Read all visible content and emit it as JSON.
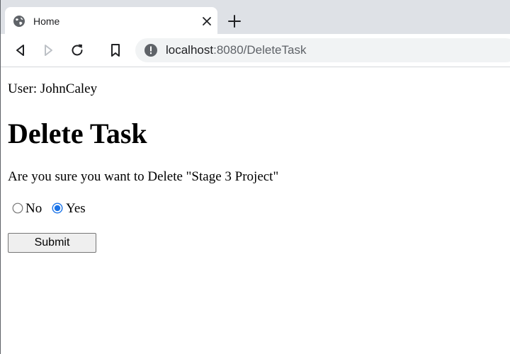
{
  "browser": {
    "tab": {
      "title": "Home",
      "favicon": "globe-icon",
      "close_icon": "close-icon"
    },
    "new_tab_icon": "plus-icon",
    "toolbar": {
      "back_icon": "back-arrow-icon",
      "forward_icon": "forward-arrow-icon",
      "reload_icon": "reload-icon",
      "bookmark_icon": "bookmark-icon",
      "site_info_icon": "info-icon"
    },
    "address": {
      "host": "localhost",
      "path": ":8080/DeleteTask"
    }
  },
  "page": {
    "user_line": "User: JohnCaley",
    "title": "Delete Task",
    "question": "Are you sure you want to Delete \"Stage 3 Project\"",
    "options": [
      {
        "label": "No",
        "checked": false
      },
      {
        "label": "Yes",
        "checked": true
      }
    ],
    "submit_label": "Submit"
  },
  "colors": {
    "tabstrip": "#dee1e6",
    "omnibox": "#f1f3f4",
    "radio_checked": "#1a73e8"
  }
}
